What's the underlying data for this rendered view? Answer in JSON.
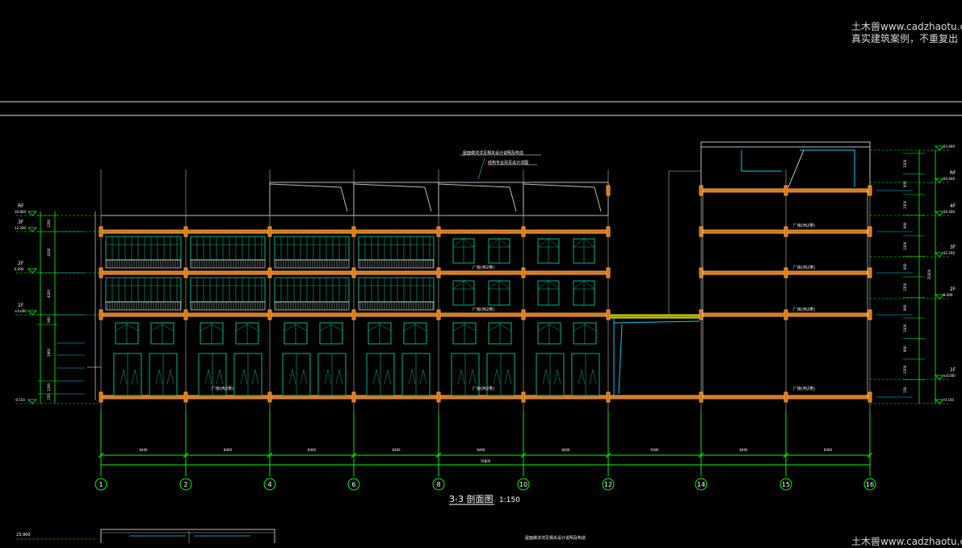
{
  "watermark": {
    "line1": "土木兽www.cadzhaotu.c",
    "line2": "真实建筑案例，不重复出",
    "line3": "土木兽www.cadzhaotu.c"
  },
  "drawing": {
    "title": "3-3 剖面图",
    "scale": "1:150",
    "roof_note_1": "屋面做法详见相关设计说明及构造",
    "roof_note_2": "结构专业另见设计详图",
    "bottom_note": "屋面做法详见相关设计说明及构造",
    "bottom_elev": "23.900",
    "axes": [
      "1",
      "2",
      "4",
      "6",
      "8",
      "10",
      "12",
      "14",
      "15",
      "16"
    ],
    "bay_dims": [
      "8400",
      "8400",
      "8400",
      "8400",
      "8400",
      "8400",
      "9300",
      "8400",
      "8400"
    ],
    "total_dim": "76800",
    "left_levels": [
      {
        "label": "RF",
        "elev": "16.800"
      },
      {
        "label": "3F",
        "elev": "12.200"
      },
      {
        "label": "2F",
        "elev": "6.000"
      },
      {
        "label": "1F",
        "elev": "±0.000"
      },
      {
        "label": "",
        "elev": "-0.150"
      }
    ],
    "right_levels": [
      {
        "label": "",
        "elev": "23.900"
      },
      {
        "label": "RF",
        "elev": "20.600"
      },
      {
        "label": "4F",
        "elev": "16.400"
      },
      {
        "label": "3F",
        "elev": "12.200"
      },
      {
        "label": "2F",
        "elev": "8.000"
      },
      {
        "label": "1F",
        "elev": "±0.000"
      },
      {
        "label": "",
        "elev": "-0.150"
      }
    ],
    "left_dims": [
      "1200",
      "4200",
      "4200",
      "900",
      "3900",
      "1200",
      "150"
    ],
    "right_dims": [
      "3300",
      "900",
      "3300",
      "900",
      "3300",
      "900",
      "3300",
      "900",
      "3300",
      "900",
      "3300",
      "150"
    ],
    "room_left": [
      "厂房(丙2类)",
      "厂房(丙2类)",
      "厂房(丙2类)"
    ],
    "room_mid": [
      "厂房(丙2类)",
      "厂房(丙2类)",
      "厂房(丙2类)"
    ],
    "room_right": [
      "厂房(丙2类)",
      "厂房(丙2类)",
      "厂房(丙2类)",
      "厂房(丙2类)"
    ]
  }
}
